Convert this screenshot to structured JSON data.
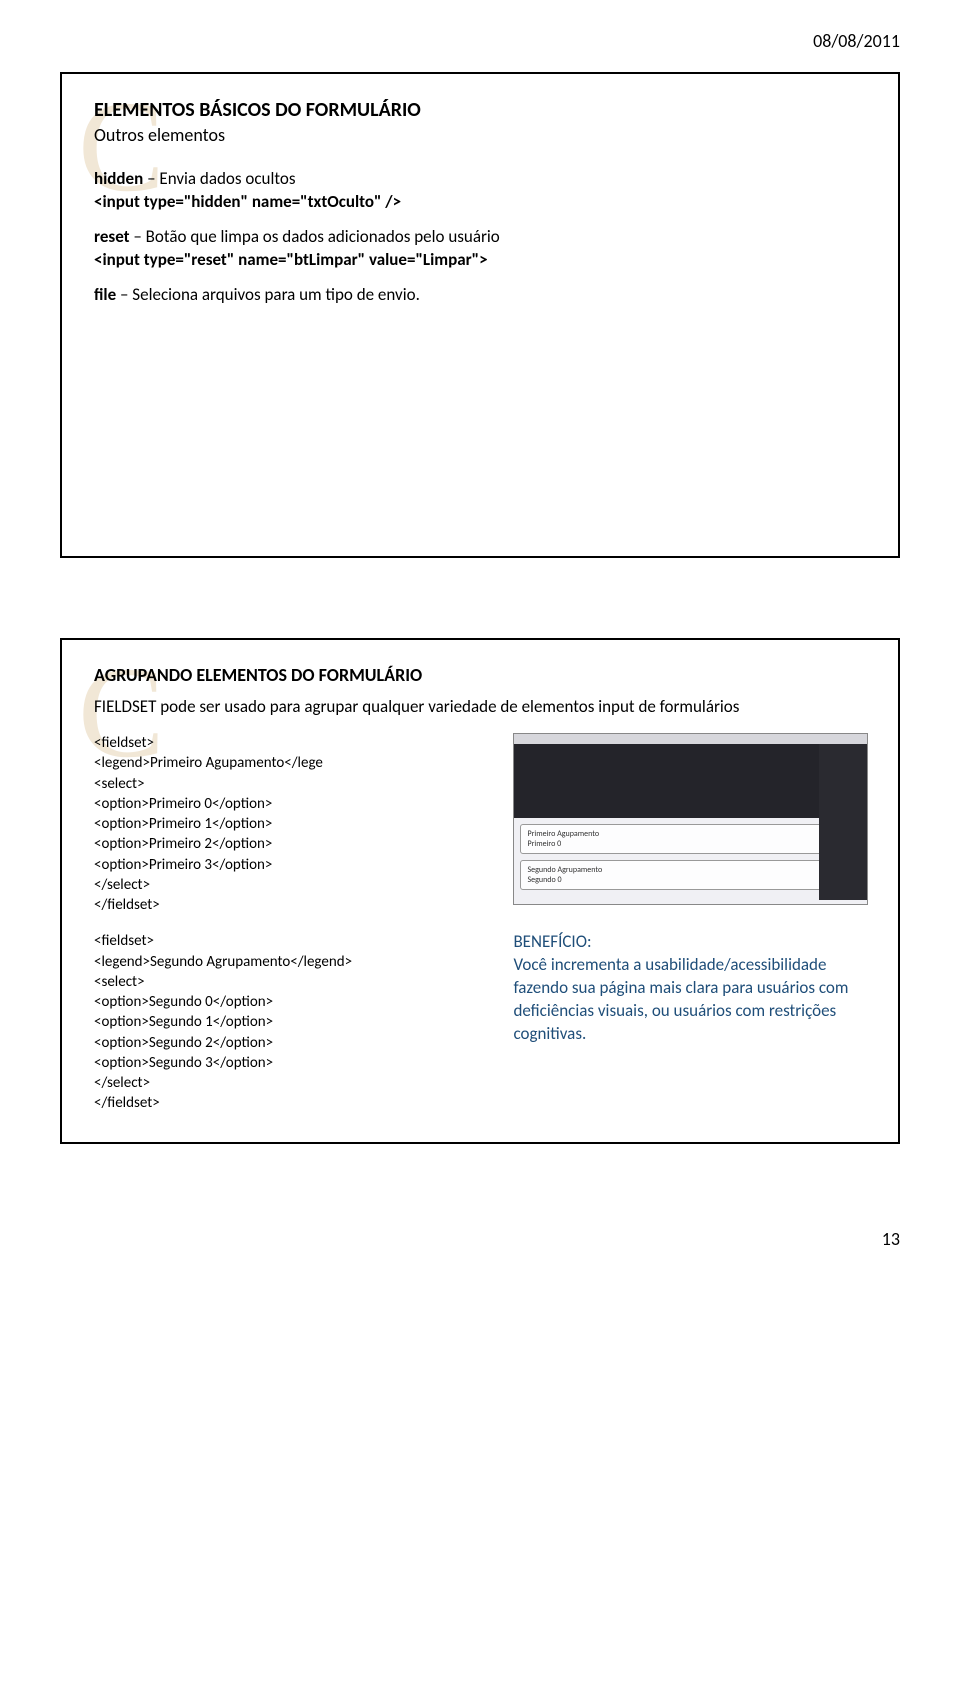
{
  "header": {
    "date": "08/08/2011"
  },
  "slide1": {
    "watermark": "C",
    "title": "ELEMENTOS BÁSICOS DO FORMULÁRIO",
    "subtitle": "Outros elementos",
    "hidden_label": "hidden",
    "hidden_desc": " – Envia dados ocultos",
    "hidden_code": "<input type=\"hidden\" name=\"txtOculto\" />",
    "reset_label": "reset",
    "reset_desc": " – Botão que limpa os dados adicionados pelo usuário",
    "reset_code": "<input type=\"reset\" name=\"btLimpar\" value=\"Limpar\">",
    "file_label": "file",
    "file_desc": " – Seleciona arquivos para um tipo de envio."
  },
  "slide2": {
    "watermark": "C",
    "title": "AGRUPANDO ELEMENTOS  DO FORMULÁRIO",
    "desc": "FIELDSET pode ser usado para agrupar qualquer variedade de elementos input de formulários",
    "code1": [
      "<fieldset>",
      "<legend>Primeiro Agupamento</lege",
      "<select>",
      "<option>Primeiro 0</option>",
      "<option>Primeiro 1</option>",
      "<option>Primeiro 2</option>",
      "<option>Primeiro 3</option>",
      "</select>",
      "</fieldset>"
    ],
    "code2": [
      "<fieldset>",
      "<legend>Segundo Agrupamento</legend>",
      "<select>",
      "<option>Segundo 0</option>",
      "<option>Segundo 1</option>",
      "<option>Segundo 2</option>",
      "<option>Segundo 3</option>",
      "</select>",
      "</fieldset>"
    ],
    "benefit_label": "BENEFÍCIO:",
    "benefit_text": "Você incrementa a usabilidade/acessibilidade fazendo sua página mais clara para usuários com deficiências visuais, ou usuários com restrições cognitivas.",
    "screenshot": {
      "legend1": "Primeiro Agupamento",
      "opt1": "Primeiro 0",
      "legend2": "Segundo Agrupamento",
      "opt2": "Segundo 0"
    }
  },
  "footer": {
    "page": "13"
  }
}
